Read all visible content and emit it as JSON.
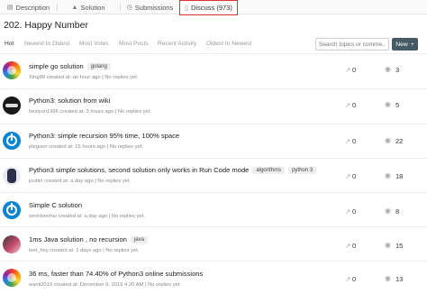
{
  "tabs": [
    {
      "label": "Description",
      "icon": "description-icon"
    },
    {
      "label": "Solution",
      "icon": "solution-icon"
    },
    {
      "label": "Submissions",
      "icon": "history-icon"
    },
    {
      "label": "Discuss (973)",
      "icon": "discuss-icon"
    }
  ],
  "problem_title": "202. Happy Number",
  "sort_options": [
    "Hot",
    "Newest to Oldest",
    "Most Votes",
    "Most Posts",
    "Recent Activity",
    "Oldest to Newest"
  ],
  "search": {
    "placeholder": "Search topics or comme..."
  },
  "new_button": {
    "label": "New",
    "icon": "+"
  },
  "colors": {
    "accent_red": "#d9342b",
    "new_button_bg": "#455a64"
  },
  "posts": [
    {
      "title": "simple go solution",
      "tags": [
        "golang"
      ],
      "user": "Xing98",
      "created": "created at: an hour ago",
      "replies": "No replies yet.",
      "votes": "0",
      "views": "3",
      "avatar": "rainbow-avatar"
    },
    {
      "title": "Python3: solution from wiki",
      "tags": [],
      "user": "hesiyun1996",
      "created": "created at: 3 hours ago",
      "replies": "No replies yet.",
      "votes": "0",
      "views": "5",
      "avatar": "dark-avatar"
    },
    {
      "title": "Python3: simple recursion 95% time, 100% space",
      "tags": [],
      "user": "pleguen",
      "created": "created at: 15 hours ago",
      "replies": "No replies yet.",
      "votes": "0",
      "views": "22",
      "avatar": "default-power-avatar"
    },
    {
      "title": "Python3 simple solutions, second solution only works in Run Code mode",
      "tags": [
        "algorithms",
        "python 3"
      ],
      "user": "joubin",
      "created": "created at: a day ago",
      "replies": "No replies yet.",
      "votes": "0",
      "views": "18",
      "avatar": "character-avatar"
    },
    {
      "title": "Simple C solution",
      "tags": [],
      "user": "senhisenhai",
      "created": "created at: a day ago",
      "replies": "No replies yet.",
      "votes": "0",
      "views": "8",
      "avatar": "default-power-avatar"
    },
    {
      "title": "1ms Java solution , no recursion",
      "tags": [
        "java"
      ],
      "user": "leet_hxy",
      "created": "created at: 2 days ago",
      "replies": "No replies yet.",
      "votes": "0",
      "views": "15",
      "avatar": "anime-avatar"
    },
    {
      "title": "36 ms, faster than 74.40% of Python3 online submissions",
      "tags": [],
      "user": "wanli2019",
      "created": "created at: December 9, 2019 4:20 AM",
      "replies": "No replies yet.",
      "votes": "0",
      "views": "13",
      "avatar": "rainbow-avatar"
    }
  ]
}
